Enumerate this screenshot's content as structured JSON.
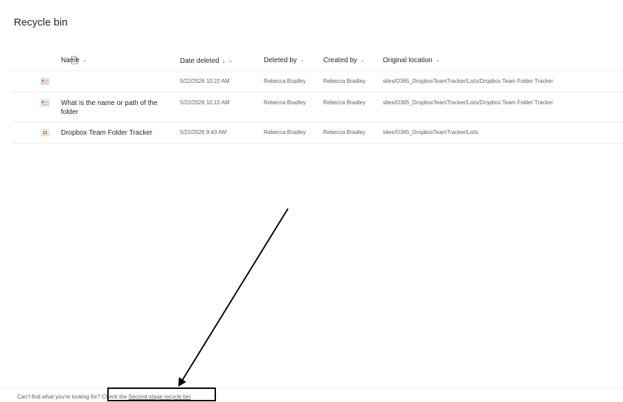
{
  "page": {
    "title": "Recycle bin"
  },
  "columns": {
    "name": "Name",
    "date_deleted": "Date deleted",
    "deleted_by": "Deleted by",
    "created_by": "Created by",
    "original_location": "Original location",
    "sort_indicator": "↓",
    "chevron": "⌄"
  },
  "rows": [
    {
      "name": "",
      "date_deleted": "5/22/2026 10:22 AM",
      "deleted_by": "Rebecca Bradley",
      "created_by": "Rebecca Bradley",
      "original_location": "sites/O365_DropboxTeamTracker/Lists/Dropbox Team Folder Tracker",
      "icon": "list-item-icon"
    },
    {
      "name": "What is the name or path of the folder",
      "date_deleted": "5/22/2026 10:10 AM",
      "deleted_by": "Rebecca Bradley",
      "created_by": "Rebecca Bradley",
      "original_location": "sites/O365_DropboxTeamTracker/Lists/Dropbox Team Folder Tracker",
      "icon": "list-item-icon"
    },
    {
      "name": "Dropbox Team Folder Tracker",
      "date_deleted": "5/22/2026 9:43 AM",
      "deleted_by": "Rebecca Bradley",
      "created_by": "Rebecca Bradley",
      "original_location": "sites/O365_DropboxTeamTracker/Lists",
      "icon": "list-icon"
    }
  ],
  "footer": {
    "prompt": "Can't find what you're looking for?",
    "check_prefix": " Check the ",
    "link_text": "Second-stage recycle bin"
  },
  "colors": {
    "icon_accent": "#e8743b",
    "icon_doc": "#c8c6c4"
  }
}
